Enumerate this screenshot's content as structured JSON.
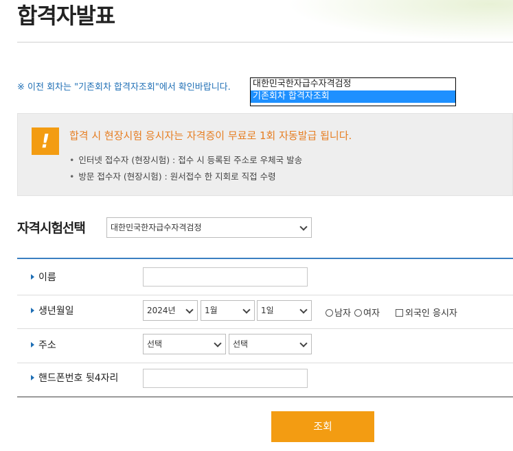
{
  "page": {
    "title": "합격자발표"
  },
  "notice": {
    "text": "※ 이전 회차는 \"기존회차 합격자조회\"에서 확인바랍니다."
  },
  "round_list": {
    "options": [
      "대한민국한자급수자격검정",
      "기존회차 합격자조회"
    ],
    "selected_index": 1
  },
  "info": {
    "headline": "합격 시 현장시험 응시자는 자격증이 무료로 1회 자동발급 됩니다.",
    "lines": [
      "인터넷 접수자 (현장시험) : 접수 시 등록된 주소로 우체국 발송",
      "방문 접수자 (현장시험) : 원서접수 한 지회로 직접 수령"
    ],
    "bullet": "•",
    "icon_symbol": "!"
  },
  "exam": {
    "label": "자격시험선택",
    "selected": "대한민국한자급수자격검정"
  },
  "form": {
    "name_label": "이름",
    "birth_label": "생년월일",
    "year": "2024년",
    "month": "1월",
    "day": "1일",
    "gender_male": "남자",
    "gender_female": "여자",
    "foreigner": "외국인 응시자",
    "address_label": "주소",
    "address_sel1": "선택",
    "address_sel2": "선택",
    "phone_label": "핸드폰번호 뒷4자리"
  },
  "submit": {
    "label": "조회"
  },
  "colors": {
    "accent_blue": "#1f6fb5",
    "accent_orange": "#f39c12",
    "selection_blue": "#1e90ff"
  }
}
